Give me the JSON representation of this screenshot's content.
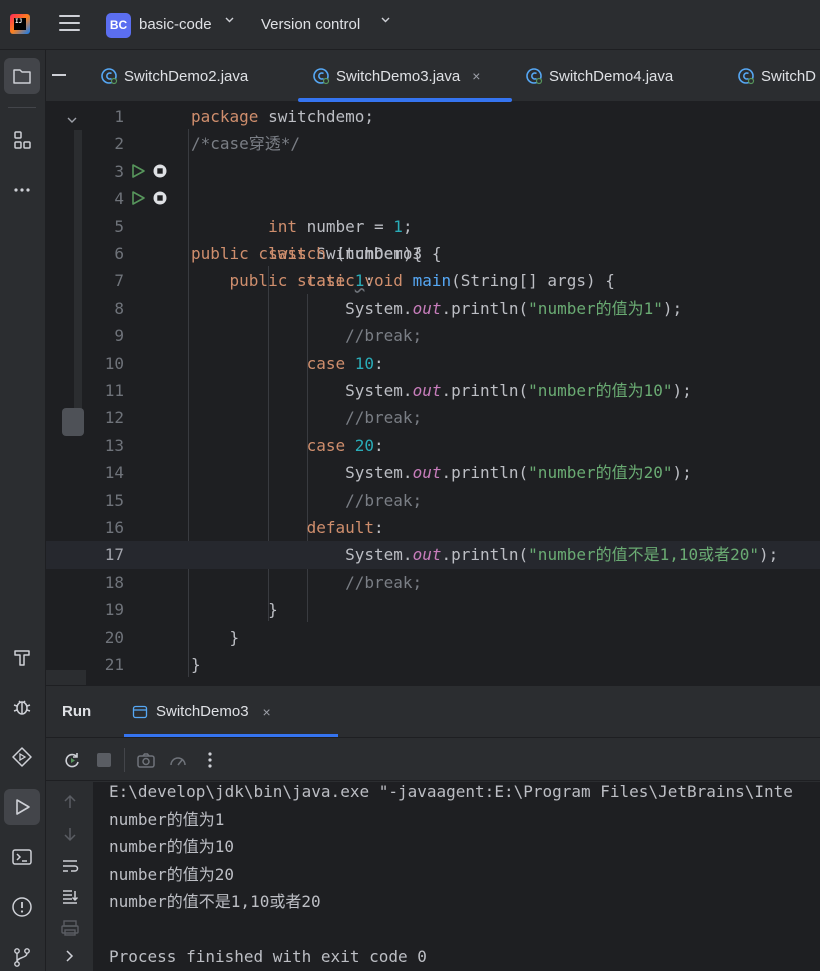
{
  "titlebar": {
    "logo_text": "IJ",
    "project_badge": "BC",
    "project_name": "basic-code",
    "vcs_label": "Version control"
  },
  "stripe": {
    "top_icons": [
      "project-folder-icon",
      "structure-icon",
      "more-icon"
    ],
    "bottom_icons": [
      "build-hammer-icon",
      "debug-bug-icon",
      "services-icon",
      "run-icon",
      "terminal-icon",
      "problems-icon",
      "git-icon"
    ]
  },
  "tabs": [
    {
      "label": "SwitchDemo2.java",
      "active": false
    },
    {
      "label": "SwitchDemo3.java",
      "active": true,
      "close": "×"
    },
    {
      "label": "SwitchDemo4.java",
      "active": false
    },
    {
      "label": "SwitchD",
      "active": false
    }
  ],
  "editor": {
    "current_line": 17,
    "line_numbers": [
      "1",
      "2",
      "3",
      "4",
      "5",
      "6",
      "7",
      "8",
      "9",
      "10",
      "11",
      "12",
      "13",
      "14",
      "15",
      "16",
      "17",
      "18",
      "19",
      "20",
      "21"
    ]
  },
  "run": {
    "title": "Run",
    "tab_label": "SwitchDemo3",
    "tab_close": "×",
    "console": [
      "E:\\develop\\jdk\\bin\\java.exe \"-javaagent:E:\\Program Files\\JetBrains\\Inte",
      "number的值为1",
      "number的值为10",
      "number的值为20",
      "number的值不是1,10或者20",
      "",
      "Process finished with exit code 0"
    ]
  },
  "colors": {
    "accent": "#3574f0",
    "keyword": "#cf8e6d",
    "number": "#2aacb8",
    "string": "#6aab73",
    "comment": "#7a7e85",
    "function": "#56a8f5",
    "static_field": "#c77dbb"
  }
}
